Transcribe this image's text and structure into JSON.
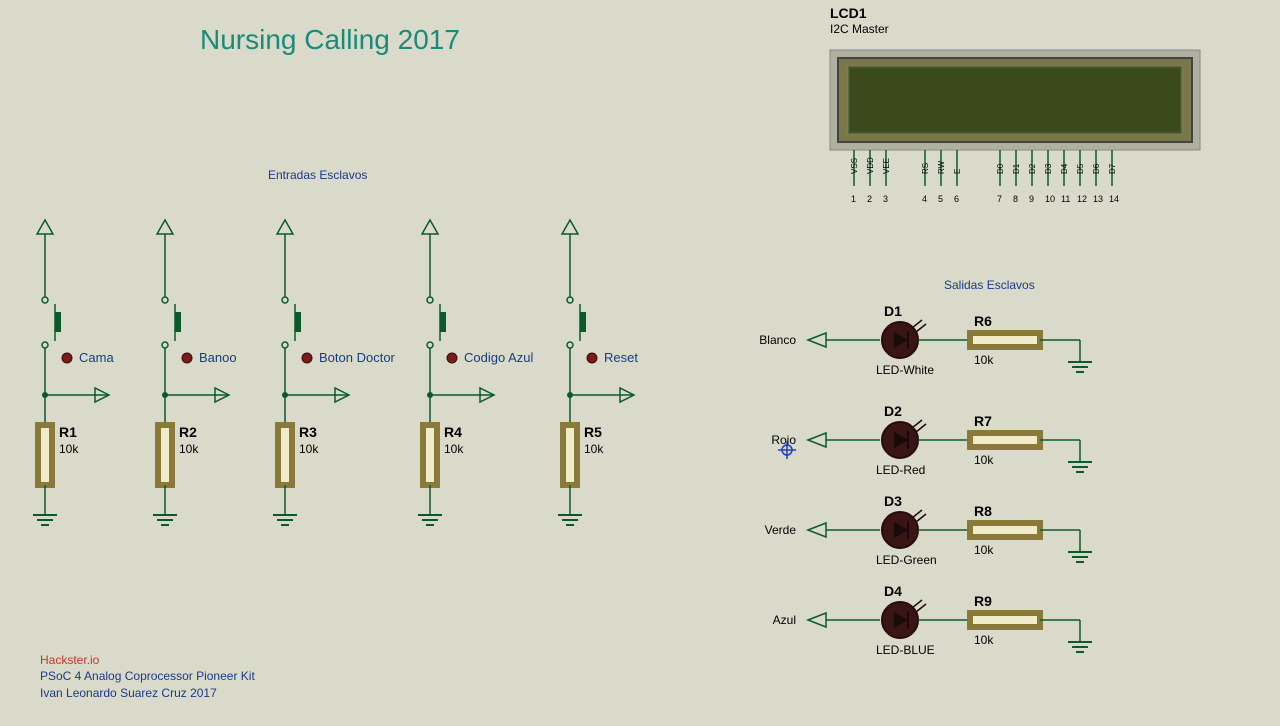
{
  "title": "Nursing Calling 2017",
  "sections": {
    "inputs": "Entradas Esclavos",
    "outputs": "Salidas Esclavos"
  },
  "lcd": {
    "ref": "LCD1",
    "type": "I2C Master",
    "pins": [
      "VSS",
      "VDD",
      "VEE",
      "RS",
      "RW",
      "E",
      "D0",
      "D1",
      "D2",
      "D3",
      "D4",
      "D5",
      "D6",
      "D7"
    ],
    "nums": [
      "1",
      "2",
      "3",
      "4",
      "5",
      "6",
      "7",
      "8",
      "9",
      "10",
      "11",
      "12",
      "13",
      "14"
    ]
  },
  "inputs": [
    {
      "label": "Cama",
      "r_ref": "R1",
      "r_val": "10k"
    },
    {
      "label": "Banoo",
      "r_ref": "R2",
      "r_val": "10k"
    },
    {
      "label": "Boton Doctor",
      "r_ref": "R3",
      "r_val": "10k"
    },
    {
      "label": "Codigo Azul",
      "r_ref": "R4",
      "r_val": "10k"
    },
    {
      "label": "Reset",
      "r_ref": "R5",
      "r_val": "10k"
    }
  ],
  "outputs": [
    {
      "net": "Blanco",
      "d_ref": "D1",
      "d_name": "LED-White",
      "r_ref": "R6",
      "r_val": "10k"
    },
    {
      "net": "Rojo",
      "d_ref": "D2",
      "d_name": "LED-Red",
      "r_ref": "R7",
      "r_val": "10k"
    },
    {
      "net": "Verde",
      "d_ref": "D3",
      "d_name": "LED-Green",
      "r_ref": "R8",
      "r_val": "10k"
    },
    {
      "net": "Azul",
      "d_ref": "D4",
      "d_name": "LED-BLUE",
      "r_ref": "R9",
      "r_val": "10k"
    }
  ],
  "credits": {
    "line1": "Hackster.io",
    "line2": "PSoC 4 Analog Coprocessor Pioneer Kit",
    "line3": "Ivan Leonardo Suarez Cruz 2017"
  },
  "chart_data": {
    "type": "schematic",
    "title": "Nursing Calling 2017",
    "components": {
      "resistors": [
        {
          "ref": "R1",
          "value": "10k"
        },
        {
          "ref": "R2",
          "value": "10k"
        },
        {
          "ref": "R3",
          "value": "10k"
        },
        {
          "ref": "R4",
          "value": "10k"
        },
        {
          "ref": "R5",
          "value": "10k"
        },
        {
          "ref": "R6",
          "value": "10k"
        },
        {
          "ref": "R7",
          "value": "10k"
        },
        {
          "ref": "R8",
          "value": "10k"
        },
        {
          "ref": "R9",
          "value": "10k"
        }
      ],
      "leds": [
        {
          "ref": "D1",
          "name": "LED-White"
        },
        {
          "ref": "D2",
          "name": "LED-Red"
        },
        {
          "ref": "D3",
          "name": "LED-Green"
        },
        {
          "ref": "D4",
          "name": "LED-BLUE"
        }
      ],
      "buttons": [
        "Cama",
        "Banoo",
        "Boton Doctor",
        "Codigo Azul",
        "Reset"
      ],
      "lcd": {
        "ref": "LCD1",
        "type": "I2C Master",
        "pins": 14
      },
      "nets_out": [
        "Blanco",
        "Rojo",
        "Verde",
        "Azul"
      ]
    }
  }
}
